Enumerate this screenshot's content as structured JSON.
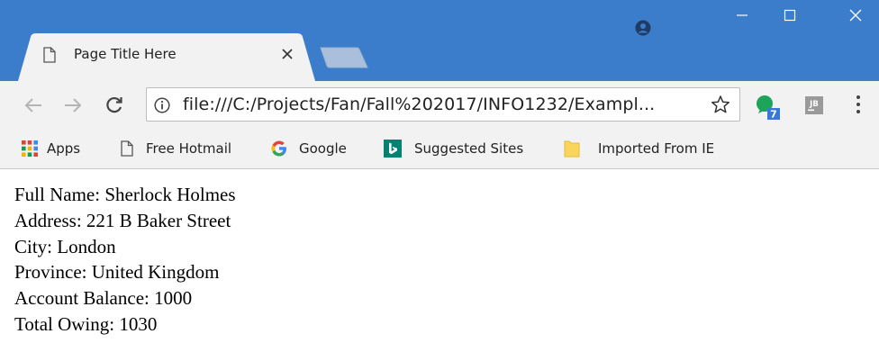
{
  "theme": {
    "frame": "#3b7dca",
    "toolbar": "#f2f2f2"
  },
  "tab": {
    "title": "Page Title Here",
    "icon": "page-icon",
    "close_icon": "close-icon"
  },
  "window": {
    "profile_icon": "account-icon",
    "minimize_icon": "minimize-icon",
    "maximize_icon": "maximize-icon",
    "close_icon": "window-close-icon"
  },
  "toolbar": {
    "url": "file:///C:/Projects/Fan/Fall%202017/INFO1232/Exampl...",
    "extension_badge": "7",
    "jb_label": "JB"
  },
  "bookmarks": [
    {
      "label": "Apps",
      "icon": "apps-grid-icon"
    },
    {
      "label": "Free Hotmail",
      "icon": "page-icon"
    },
    {
      "label": "Google",
      "icon": "google-icon"
    },
    {
      "label": "Suggested Sites",
      "icon": "bing-icon"
    },
    {
      "label": "Imported From IE",
      "icon": "folder-icon"
    }
  ],
  "page": {
    "lines": [
      "Full Name: Sherlock Holmes",
      "Address: 221 B Baker Street",
      "City: London",
      "Province: United Kingdom",
      "Account Balance: 1000",
      "Total Owing: 1030"
    ]
  }
}
